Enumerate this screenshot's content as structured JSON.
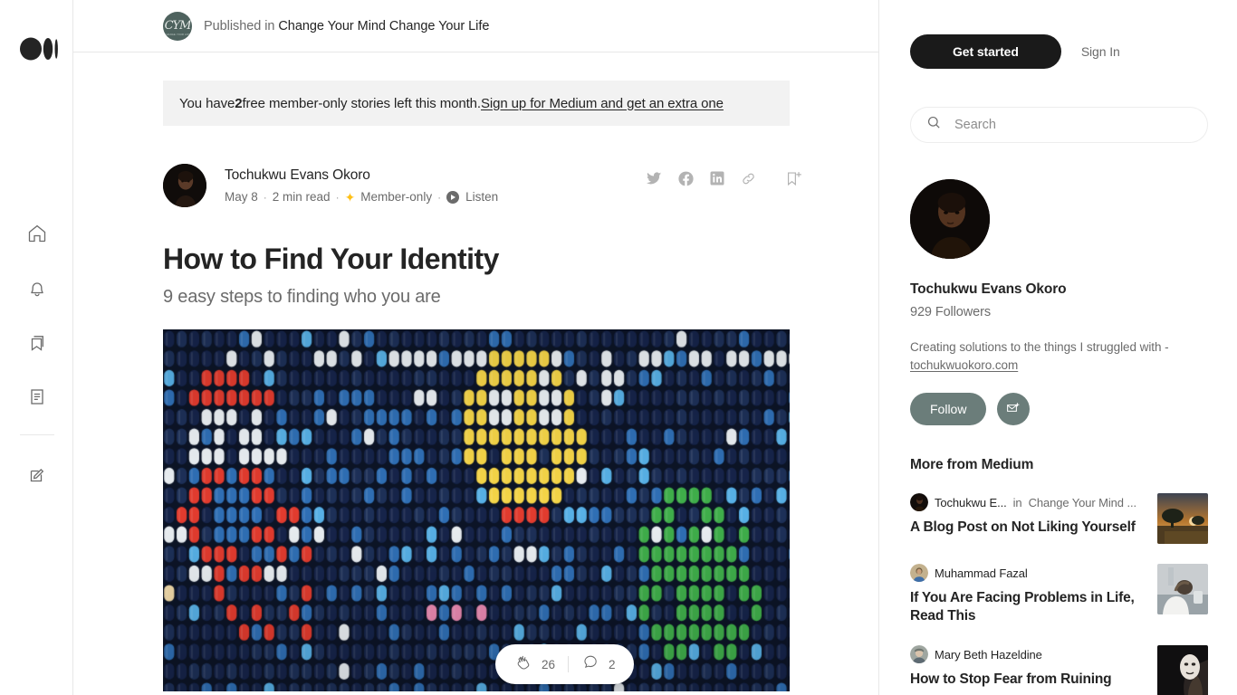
{
  "rail": {
    "logo_name": "medium-logo",
    "items": [
      {
        "name": "home-icon",
        "label": "Home"
      },
      {
        "name": "bell-icon",
        "label": "Notifications"
      },
      {
        "name": "bookmark-icon",
        "label": "Bookmarks"
      },
      {
        "name": "reading-list-icon",
        "label": "Lists"
      },
      {
        "name": "write-icon",
        "label": "Write"
      }
    ]
  },
  "publication": {
    "prefix": "Published in",
    "name": "Change Your Mind Change Your Life",
    "logo_monogram": "CYM",
    "logo_sub": "CHANGE YOUR LIFE",
    "logo_color": "#4e625e"
  },
  "notice": {
    "text_before": "You have ",
    "count": "2",
    "text_after": " free member-only stories left this month. ",
    "link": "Sign up for Medium and get an extra one",
    "background": "#f2f2f2"
  },
  "article": {
    "author": "Tochukwu Evans Okoro",
    "date": "May 8",
    "read_time": "2 min read",
    "member_badge": "Member-only",
    "listen": "Listen",
    "title": "How to Find Your Identity",
    "subtitle": "9 easy steps to finding who you are",
    "star_color": "#ffc017",
    "share_icons": [
      "twitter-icon",
      "facebook-icon",
      "linkedin-icon",
      "link-icon"
    ],
    "bookmark_icon": "add-to-list-icon"
  },
  "hero": {
    "alt": "pixel-art mosaic made of colored pill capsules",
    "background": "#111a2e",
    "palette": [
      "#0f1a30",
      "#1b2c52",
      "#2f6fb5",
      "#57b0e6",
      "#8ecdf2",
      "#e23b2e",
      "#f2c100",
      "#f5d547",
      "#3fae4a",
      "#e9eef2",
      "#f0d9a8",
      "#e888b0"
    ]
  },
  "engagement": {
    "clap_icon": "clap-icon",
    "claps": "26",
    "comment_icon": "comment-icon",
    "comments": "2"
  },
  "sidebar": {
    "get_started": "Get started",
    "sign_in": "Sign In",
    "search_placeholder": "Search",
    "search_value": "",
    "search_icon": "search-icon",
    "profile": {
      "name": "Tochukwu Evans Okoro",
      "followers": "929 Followers",
      "bio_text": "Creating solutions to the things I struggled with - ",
      "bio_link": "tochukwuokoro.com",
      "follow_label": "Follow",
      "mail_icon": "envelope-plus-icon",
      "accent": "#6b7d7a"
    },
    "more_heading": "More from Medium",
    "recommendations": [
      {
        "author": "Tochukwu E...",
        "in_label": "in",
        "publication": "Change Your Mind ...",
        "title": "A Blog Post on Not Liking Yourself",
        "thumb": "sunset-landscape-thumbnail"
      },
      {
        "author": "Muhammad Fazal",
        "in_label": "",
        "publication": "",
        "title": "If You Are Facing Problems in Life, Read This",
        "thumb": "person-hands-on-head-thumbnail"
      },
      {
        "author": "Mary Beth Hazeldine",
        "in_label": "",
        "publication": "",
        "title": "How to Stop Fear from Ruining",
        "thumb": "mask-portrait-thumbnail"
      }
    ]
  }
}
